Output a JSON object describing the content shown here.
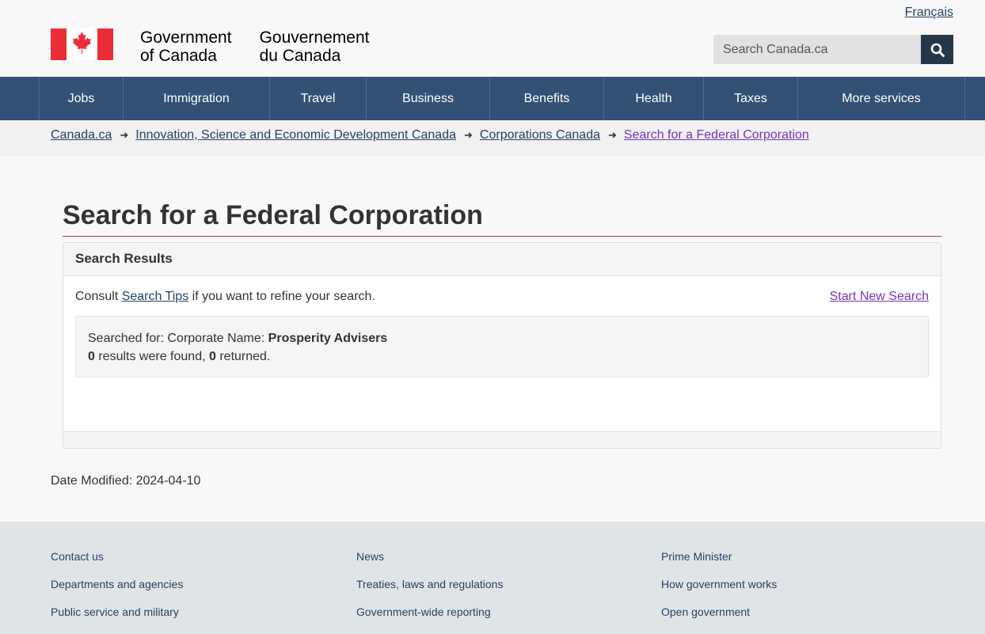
{
  "header": {
    "language_link": "Français",
    "wordmark_en_line1": "Government",
    "wordmark_en_line2": "of Canada",
    "wordmark_fr_line1": "Gouvernement",
    "wordmark_fr_line2": "du Canada",
    "search_placeholder": "Search Canada.ca",
    "search_icon": "search-icon"
  },
  "nav": {
    "items": [
      {
        "label": "Jobs"
      },
      {
        "label": "Immigration"
      },
      {
        "label": "Travel"
      },
      {
        "label": "Business"
      },
      {
        "label": "Benefits"
      },
      {
        "label": "Health"
      },
      {
        "label": "Taxes"
      },
      {
        "label": "More services"
      }
    ]
  },
  "breadcrumb": {
    "items": [
      {
        "label": "Canada.ca"
      },
      {
        "label": "Innovation, Science and Economic Development Canada"
      },
      {
        "label": "Corporations Canada"
      },
      {
        "label": "Search for a Federal Corporation"
      }
    ]
  },
  "main": {
    "title": "Search for a Federal Corporation",
    "panel_title": "Search Results",
    "consult_prefix": "Consult ",
    "consult_link": "Search Tips",
    "consult_suffix": " if you want to refine your search.",
    "new_search_link": "Start New Search",
    "searched_for_prefix": "Searched for: Corporate Name: ",
    "searched_for_value": "Prosperity Advisers",
    "results_found": "0",
    "results_found_text": " results were found, ",
    "results_returned": "0",
    "results_returned_text": " returned.",
    "date_modified_label": "Date Modified: ",
    "date_modified": "2024-04-10"
  },
  "footer": {
    "col1": [
      "Contact us",
      "Departments and agencies",
      "Public service and military"
    ],
    "col2": [
      "News",
      "Treaties, laws and regulations",
      "Government-wide reporting"
    ],
    "col3": [
      "Prime Minister",
      "How government works",
      "Open government"
    ]
  },
  "colors": {
    "nav_bg": "#335075",
    "search_button_bg": "#26374a",
    "title_rule": "#af3c43",
    "flag_red": "#eb2d37",
    "visited_link": "#7834bc"
  }
}
